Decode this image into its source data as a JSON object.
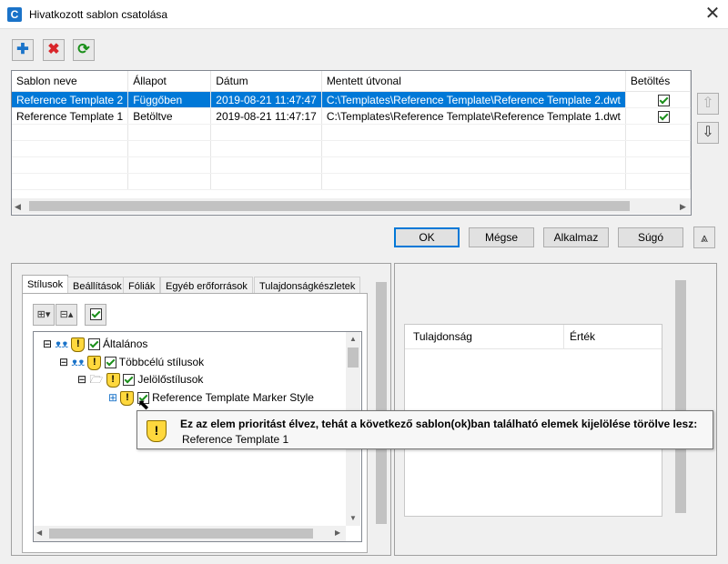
{
  "window": {
    "title": "Hivatkozott sablon csatolása",
    "app_icon_letter": "C"
  },
  "toolbar": {
    "add_glyph": "✚",
    "remove_glyph": "✖",
    "refresh_glyph": "⟳"
  },
  "grid": {
    "columns": [
      "Sablon neve",
      "Állapot",
      "Dátum",
      "Mentett útvonal",
      "Betöltés"
    ],
    "rows": [
      {
        "name": "Reference Template 2",
        "state": "Függőben",
        "date": "2019-08-21 11:47:47",
        "path": "C:\\Templates\\Reference Template\\Reference Template 2.dwt",
        "loaded": true,
        "selected": true
      },
      {
        "name": "Reference Template 1",
        "state": "Betöltve",
        "date": "2019-08-21 11:47:17",
        "path": "C:\\Templates\\Reference Template\\Reference Template 1.dwt",
        "loaded": true,
        "selected": false
      }
    ]
  },
  "buttons": {
    "ok": "OK",
    "cancel": "Mégse",
    "apply": "Alkalmaz",
    "help": "Súgó",
    "move_up_glyph": "⇧",
    "move_down_glyph": "⇩",
    "collapse_glyph": "⩓"
  },
  "tabs": [
    "Stílusok",
    "Beállítások",
    "Fóliák",
    "Egyéb erőforrások",
    "Tulajdonságkészletek"
  ],
  "tree": {
    "nodes": [
      {
        "label": "Általános",
        "checked": true
      },
      {
        "label": "Többcélú stílusok",
        "checked": true
      },
      {
        "label": "Jelölőstílusok",
        "checked": true
      },
      {
        "label": "Reference Template Marker Style",
        "checked": true
      }
    ]
  },
  "properties": {
    "col_property": "Tulajdonság",
    "col_value": "Érték"
  },
  "tooltip": {
    "message": "Ez az elem prioritást élvez, tehát a következő sablon(ok)ban található elemek kijelölése törölve lesz:",
    "item": "Reference Template 1",
    "icon": "!"
  },
  "colors": {
    "selection": "#0078d7",
    "warning": "#ffd83d",
    "remove": "#d9252a",
    "add": "#1a73c9",
    "refresh": "#1a8f1a"
  }
}
